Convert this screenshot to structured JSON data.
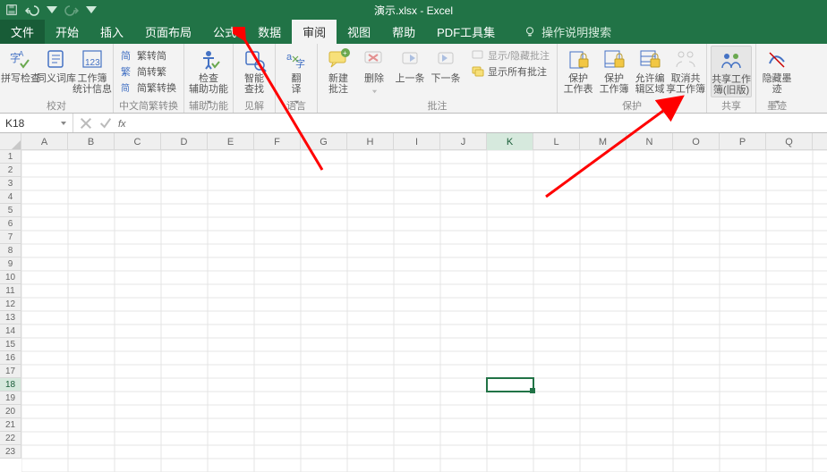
{
  "window": {
    "title": "演示.xlsx - Excel"
  },
  "qat": {
    "save": "保存",
    "undo": "撤销",
    "redo": "恢复"
  },
  "tabs": {
    "file": "文件",
    "items": [
      "开始",
      "插入",
      "页面布局",
      "公式",
      "数据",
      "审阅",
      "视图",
      "帮助",
      "PDF工具集"
    ],
    "active": "审阅",
    "search": "操作说明搜索"
  },
  "ribbon": {
    "proof": {
      "group": "校对",
      "spell": "拼写检查",
      "thesaurus": "同义词库",
      "stats": "工作簿\n统计信息"
    },
    "chinese": {
      "group": "中文简繁转换",
      "sc": "繁转简",
      "tc": "简转繁",
      "convert": "简繁转换"
    },
    "acc": {
      "group": "辅助功能",
      "check": "检查\n辅助功能"
    },
    "insight": {
      "group": "见解",
      "smart": "智能\n查找"
    },
    "lang": {
      "group": "语言",
      "translate": "翻\n译"
    },
    "comments": {
      "group": "批注",
      "new": "新建\n批注",
      "delete": "删除",
      "prev": "上一条",
      "next": "下一条",
      "showhide": "显示/隐藏批注",
      "showall": "显示所有批注"
    },
    "protect": {
      "group": "保护",
      "sheet": "保护\n工作表",
      "workbook": "保护\n工作簿",
      "ranges": "允许编\n辑区域",
      "unshare": "取消共\n享工作簿"
    },
    "share": {
      "group": "共享",
      "btn": "共享工作\n簿(旧版)"
    },
    "ink": {
      "group": "墨迹",
      "hide": "隐藏墨\n迹"
    }
  },
  "namebox": {
    "value": "K18"
  },
  "formula": {
    "value": ""
  },
  "columns": [
    "A",
    "B",
    "C",
    "D",
    "E",
    "F",
    "G",
    "H",
    "I",
    "J",
    "K",
    "L",
    "M",
    "N",
    "O",
    "P",
    "Q"
  ],
  "rows": [
    "1",
    "2",
    "3",
    "4",
    "5",
    "6",
    "7",
    "8",
    "9",
    "10",
    "11",
    "12",
    "13",
    "14",
    "15",
    "16",
    "17",
    "18",
    "19",
    "20",
    "21",
    "22",
    "23"
  ],
  "selection": {
    "col": "K",
    "row": "18"
  }
}
